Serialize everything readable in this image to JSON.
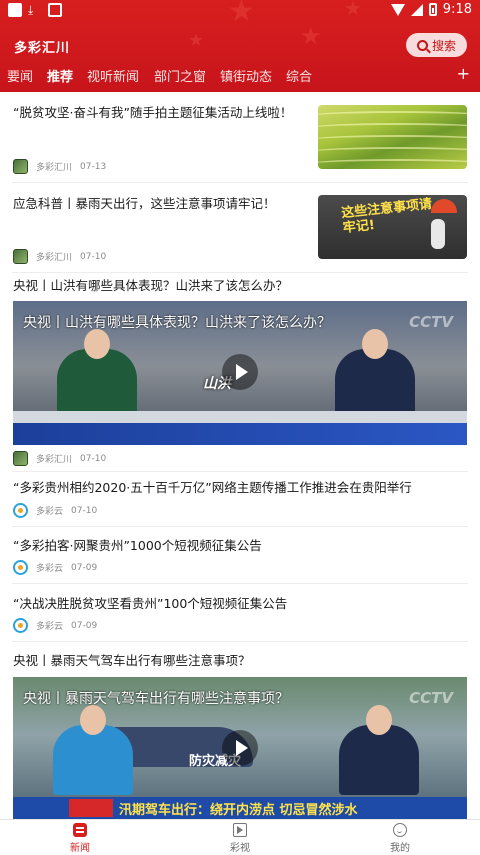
{
  "status_bar": {
    "time": "9:18"
  },
  "header": {
    "app_title": "多彩汇川",
    "search_label": "搜索",
    "tabs": [
      "要闻",
      "推荐",
      "视听新闻",
      "部门之窗",
      "镇街动态",
      "综合"
    ],
    "active_tab": "推荐",
    "add_tab_label": "+"
  },
  "feed": [
    {
      "title": "“脱贫攻坚·奋斗有我”随手拍主题征集活动上线啦！",
      "source": "多彩汇川",
      "date": "07-13"
    },
    {
      "title": "应急科普丨暴雨天出行，这些注意事项请牢记！",
      "source": "多彩汇川",
      "date": "07-10",
      "thumb_text": "这些注意事项请牢记!"
    },
    {
      "title": "央视丨山洪有哪些具体表现？山洪来了该怎么办？",
      "source": "多彩汇川",
      "date": "07-10",
      "video_caption": "央视丨山洪有哪些具体表现？山洪来了该怎么办？",
      "video_logo": "CCTV",
      "video_overlay": "山洪"
    },
    {
      "title": "“多彩贵州相约2020·五十百千万亿”网络主题传播工作推进会在贵阳举行",
      "source": "多彩云",
      "date": "07-10"
    },
    {
      "title": "“多彩拍客·网聚贵州”1000个短视频征集公告",
      "source": "多彩云",
      "date": "07-09"
    },
    {
      "title": "“决战决胜脱贫攻坚看贵州”100个短视频征集公告",
      "source": "多彩云",
      "date": "07-09"
    },
    {
      "title": "央视丨暴雨天气驾车出行有哪些注意事项？",
      "video_caption": "央视丨暴雨天气驾车出行有哪些注意事项？",
      "video_logo": "CCTV",
      "video_overlay": "防灾减灾",
      "ticker_text": "汛期驾车出行：绕开内涝点  切忌冒然涉水"
    }
  ],
  "bottom_nav": [
    {
      "label": "新闻",
      "icon": "news-icon",
      "active": true
    },
    {
      "label": "彩视",
      "icon": "video-icon",
      "active": false
    },
    {
      "label": "我的",
      "icon": "me-icon",
      "active": false
    }
  ],
  "colors": {
    "brand_red": "#d81f1f",
    "text": "#1a1a1a",
    "meta": "#8a8a8a"
  }
}
